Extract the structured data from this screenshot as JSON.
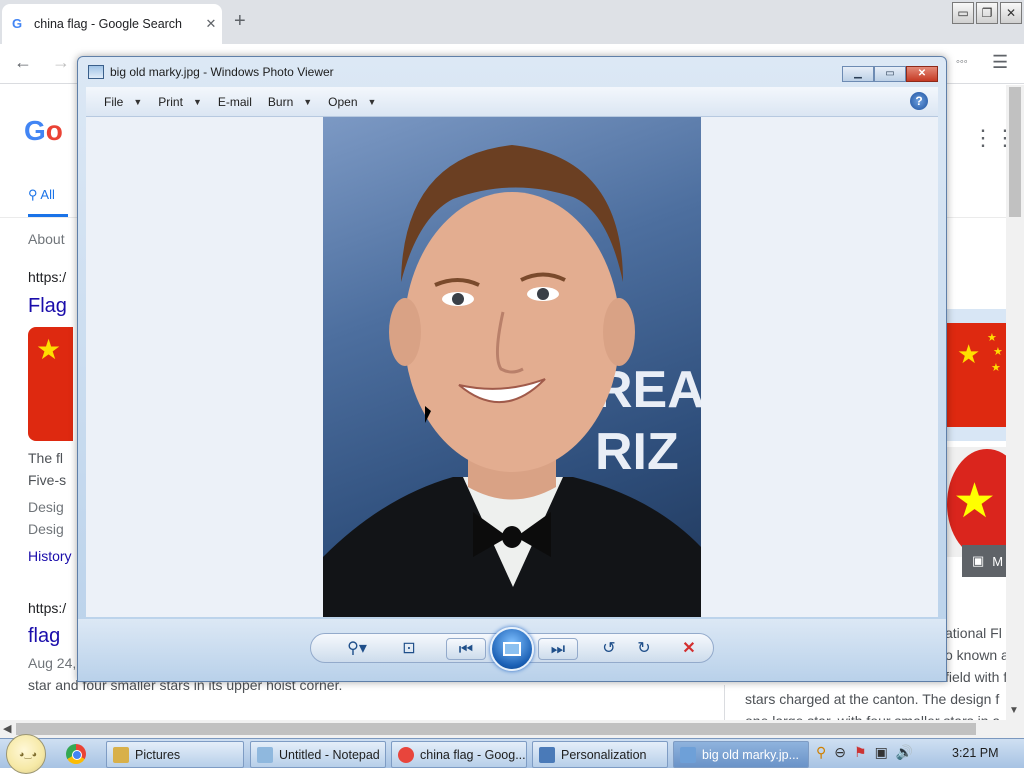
{
  "browser": {
    "tab_title": "china flag - Google Search",
    "tab_close": "✕",
    "newtab": "+",
    "back": "←",
    "forward": "→",
    "window_controls": [
      "▭",
      "❐",
      "✕"
    ],
    "extension_glyph": "◦◦◦",
    "menu_glyph": "☰"
  },
  "google": {
    "logo_left": "G",
    "logo_right": "o",
    "apps_glyph": "⋮⋮⋮",
    "all_tab": "All",
    "about": "About",
    "results": [
      {
        "url": "https:/",
        "title": "Flag",
        "text1": "The fl",
        "text2": "Five-s",
        "meta1": "Desig",
        "meta2": "Desig",
        "link": "History"
      },
      {
        "url": "https:/",
        "title": "flag",
        "date": "Aug 24,",
        "text": "star and four smaller stars in its upper hoist corner."
      }
    ],
    "right_panel": {
      "line1": "ational Fl",
      "line2": "o known as",
      "line3": "field with f",
      "line4": "stars charged at the canton. The design f",
      "line5": "one large star, with four smaller stars in a"
    },
    "more_button": "M"
  },
  "photo_viewer": {
    "title": "big old marky.jpg - Windows Photo Viewer",
    "window_controls": [
      "▁",
      "▭",
      "✕"
    ],
    "menu": [
      {
        "label": "File",
        "caret": "▼"
      },
      {
        "label": "Print",
        "caret": "▼"
      },
      {
        "label": "E-mail",
        "caret": ""
      },
      {
        "label": "Burn",
        "caret": "▼"
      },
      {
        "label": "Open",
        "caret": "▼"
      }
    ],
    "help": "?",
    "photo_text_1": "REA",
    "photo_text_2": "RIZ",
    "controls": {
      "zoom": "⚲▾",
      "actual_size": "⊡",
      "previous": "⏮",
      "next": "⏭",
      "rotate_ccw": "↺",
      "rotate_cw": "↻",
      "delete": "✕"
    }
  },
  "taskbar": {
    "items": [
      {
        "label": "Pictures",
        "color": "#d8b04a"
      },
      {
        "label": "Untitled - Notepad",
        "color": "#8fb8de"
      },
      {
        "label": "china flag - Goog...",
        "color": "#e8453c"
      },
      {
        "label": "Personalization",
        "color": "#4a7ab8"
      },
      {
        "label": "big old marky.jp...",
        "color": "#6ea0d8"
      }
    ],
    "tray": [
      "⚲",
      "⊖",
      "⚑",
      "▣",
      "🔊"
    ],
    "clock": "3:21 PM"
  }
}
